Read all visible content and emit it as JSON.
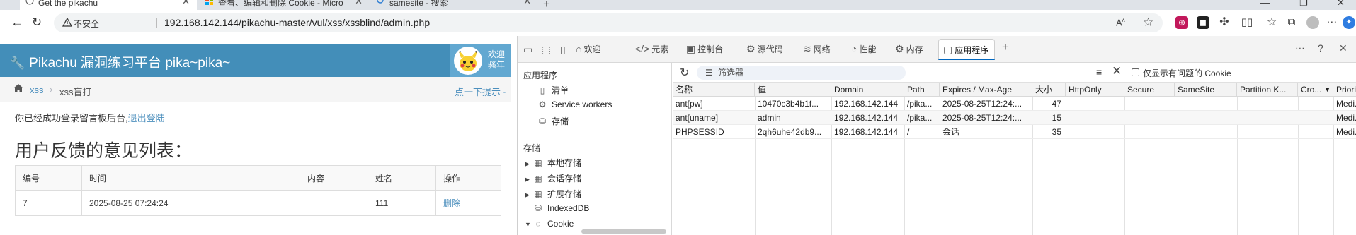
{
  "browser": {
    "tabs": [
      {
        "title": "Get the pikachu",
        "active": true
      },
      {
        "title": "查看、编辑和删除 Cookie - Micro",
        "active": false
      },
      {
        "title": "samesite - 搜索",
        "active": false
      }
    ],
    "omnibox": {
      "security_label": "不安全",
      "url": "192.168.142.144/pikachu-master/vul/xss/xssblind/admin.php"
    }
  },
  "page": {
    "brand": "Pikachu 漏洞练习平台 pika~pika~",
    "welcome": [
      "欢迎",
      "骚年"
    ],
    "breadcrumb": {
      "section": "xss",
      "current": "xss盲打",
      "hint": "点一下提示~"
    },
    "login_msg": "你已经成功登录留言板后台,",
    "logout_link": "退出登陆",
    "list_title": "用户反馈的意见列表：",
    "table": {
      "headers": [
        "编号",
        "时间",
        "内容",
        "姓名",
        "操作"
      ],
      "rows": [
        {
          "id": "7",
          "time": "2025-08-25 07:24:24",
          "content": "",
          "name": "111",
          "action": "删除"
        }
      ]
    }
  },
  "devtools": {
    "tabs": [
      {
        "label": "欢迎",
        "icon": "home-icon"
      },
      {
        "label": "元素",
        "icon": "code-icon"
      },
      {
        "label": "控制台",
        "icon": "console-icon"
      },
      {
        "label": "源代码",
        "icon": "bug-icon"
      },
      {
        "label": "网络",
        "icon": "wifi-icon"
      },
      {
        "label": "性能",
        "icon": "gauge-icon"
      },
      {
        "label": "内存",
        "icon": "memory-icon"
      },
      {
        "label": "应用程序",
        "icon": "application-icon",
        "active": true
      }
    ],
    "sidebar": {
      "app_heading": "应用程序",
      "app_items": [
        "清单",
        "Service workers",
        "存储"
      ],
      "storage_heading": "存储",
      "storage_items": [
        "本地存储",
        "会话存储",
        "扩展存储",
        "IndexedDB",
        "Cookie"
      ]
    },
    "toolbar": {
      "filter_placeholder": "筛选器",
      "only_issues_label": "仅显示有问题的 Cookie"
    },
    "cookie_table": {
      "columns": [
        "名称",
        "值",
        "Domain",
        "Path",
        "Expires / Max-Age",
        "大小",
        "HttpOnly",
        "Secure",
        "SameSite",
        "Partition K...",
        "Cro...",
        "Priority"
      ],
      "rows": [
        {
          "name": "ant[pw]",
          "value": "10470c3b4b1f...",
          "domain": "192.168.142.144",
          "path": "/pika...",
          "expires": "2025-08-25T12:24:...",
          "size": "47",
          "priority": "Medi..."
        },
        {
          "name": "ant[uname]",
          "value": "admin",
          "domain": "192.168.142.144",
          "path": "/pika...",
          "expires": "2025-08-25T12:24:...",
          "size": "15",
          "priority": "Medi..."
        },
        {
          "name": "PHPSESSID",
          "value": "2qh6uhe42db9...",
          "domain": "192.168.142.144",
          "path": "/",
          "expires": "会话",
          "size": "35",
          "priority": "Medi..."
        }
      ]
    }
  },
  "colors": {
    "pikachu_blue": "#438eb9",
    "link_blue": "#4c8fbd",
    "devtools_accent": "#0067c0"
  }
}
